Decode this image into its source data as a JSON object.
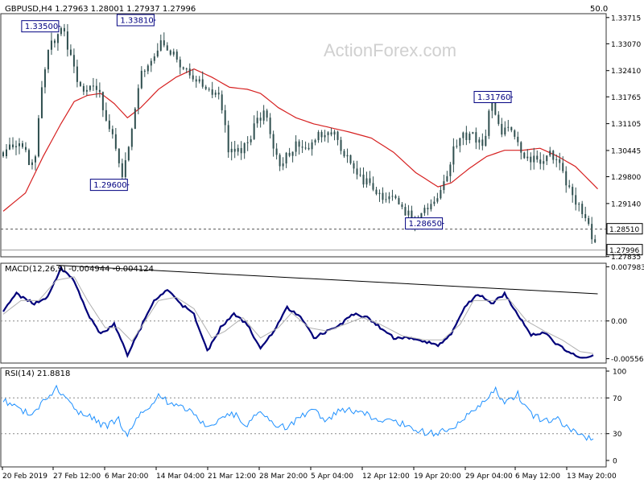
{
  "header": {
    "symbol_info": "GBPUSD,H4  1.27963 1.28001 1.27937 1.27996",
    "corner_value": "50.0",
    "watermark": "ActionForex.com"
  },
  "colors": {
    "candle": "#2f4f4f",
    "ma": "#d62020",
    "macd": "#00007a",
    "signal": "#b0b0b0",
    "rsi": "#1e90ff",
    "callout": "#000080",
    "grid": "#333333"
  },
  "chart_data": [
    {
      "type": "candlestick",
      "panel": "price",
      "title": "",
      "ylim": [
        1.2783,
        1.3381
      ],
      "y_ticks": [
        "1.33715",
        "1.33070",
        "1.32410",
        "1.31765",
        "1.31105",
        "1.30445",
        "1.29800",
        "1.29140",
        "1.28510",
        "1.27996",
        "1.27835"
      ],
      "x_ticks": [
        "20 Feb 2019",
        "27 Feb 12:00",
        "6 Mar 20:00",
        "14 Mar 04:00",
        "21 Mar 12:00",
        "28 Mar 20:00",
        "5 Apr 04:00",
        "12 Apr 12:00",
        "19 Apr 20:00",
        "29 Apr 04:00",
        "6 May 12:00",
        "13 May 20:00"
      ],
      "bars_shown": 185,
      "anchors": [
        [
          0,
          1.304
        ],
        [
          8,
          1.306
        ],
        [
          14,
          1.299
        ],
        [
          18,
          1.324
        ],
        [
          22,
          1.3305
        ],
        [
          27,
          1.335
        ],
        [
          30,
          1.328
        ],
        [
          35,
          1.32
        ],
        [
          42,
          1.3205
        ],
        [
          47,
          1.312
        ],
        [
          54,
          1.2975
        ],
        [
          57,
          1.306
        ],
        [
          62,
          1.3235
        ],
        [
          66,
          1.326
        ],
        [
          72,
          1.331
        ],
        [
          78,
          1.327
        ],
        [
          85,
          1.322
        ],
        [
          90,
          1.3215
        ],
        [
          98,
          1.318
        ],
        [
          102,
          1.3035
        ],
        [
          108,
          1.304
        ],
        [
          112,
          1.309
        ],
        [
          118,
          1.314
        ],
        [
          124,
          1.301
        ],
        [
          132,
          1.3065
        ],
        [
          138,
          1.306
        ],
        [
          142,
          1.309
        ],
        [
          150,
          1.3075
        ],
        [
          156,
          1.3015
        ],
        [
          160,
          1.299
        ],
        [
          164,
          1.296
        ],
        [
          170,
          1.2935
        ],
        [
          176,
          1.2925
        ],
        [
          182,
          1.2895
        ],
        [
          186,
          1.287
        ],
        [
          194,
          1.292
        ],
        [
          200,
          1.2975
        ],
        [
          204,
          1.3065
        ],
        [
          210,
          1.3085
        ],
        [
          216,
          1.305
        ],
        [
          220,
          1.317
        ],
        [
          224,
          1.308
        ],
        [
          228,
          1.3115
        ],
        [
          232,
          1.305
        ],
        [
          236,
          1.3035
        ],
        [
          242,
          1.3015
        ],
        [
          246,
          1.304
        ],
        [
          252,
          1.299
        ],
        [
          256,
          1.2935
        ],
        [
          262,
          1.288
        ],
        [
          266,
          1.283
        ],
        [
          268,
          1.28
        ]
      ],
      "moving_average_anchors": [
        [
          0,
          1.2895
        ],
        [
          10,
          1.294
        ],
        [
          18,
          1.303
        ],
        [
          26,
          1.311
        ],
        [
          32,
          1.3165
        ],
        [
          38,
          1.318
        ],
        [
          44,
          1.3185
        ],
        [
          50,
          1.316
        ],
        [
          56,
          1.3125
        ],
        [
          62,
          1.315
        ],
        [
          70,
          1.3195
        ],
        [
          78,
          1.3225
        ],
        [
          86,
          1.3245
        ],
        [
          94,
          1.3225
        ],
        [
          102,
          1.32
        ],
        [
          110,
          1.3195
        ],
        [
          116,
          1.3185
        ],
        [
          124,
          1.315
        ],
        [
          132,
          1.3125
        ],
        [
          140,
          1.311
        ],
        [
          148,
          1.31
        ],
        [
          156,
          1.309
        ],
        [
          166,
          1.3075
        ],
        [
          176,
          1.304
        ],
        [
          186,
          1.299
        ],
        [
          196,
          1.2955
        ],
        [
          202,
          1.2965
        ],
        [
          210,
          1.3
        ],
        [
          218,
          1.303
        ],
        [
          226,
          1.3045
        ],
        [
          234,
          1.3045
        ],
        [
          242,
          1.305
        ],
        [
          250,
          1.303
        ],
        [
          258,
          1.3005
        ],
        [
          268,
          1.295
        ]
      ],
      "callouts": [
        {
          "label": "1.33500",
          "i": 25,
          "price": 1.335,
          "pos": "left"
        },
        {
          "label": "1.33810",
          "i": 68,
          "price": 1.3381,
          "pos": "left"
        },
        {
          "label": "1.29600",
          "i": 56,
          "price": 1.296,
          "pos": "left"
        },
        {
          "label": "1.31760",
          "i": 229,
          "price": 1.3176,
          "pos": "left"
        },
        {
          "label": "1.28650",
          "i": 198,
          "price": 1.2865,
          "pos": "left"
        }
      ],
      "reference_lines": [
        {
          "price": 1.2851,
          "label": "1.28510",
          "style": "dashed"
        },
        {
          "price": 1.27996,
          "label": "1.27996",
          "style": "solid"
        }
      ]
    },
    {
      "type": "line",
      "panel": "macd",
      "title": "MACD(12,26,9) -0.004944 -0.004124",
      "ylim": [
        -0.0062,
        0.0085
      ],
      "y_ticks": [
        {
          "label": "0.007983",
          "value": 0.007983
        },
        {
          "label": "0.00",
          "value": 0.0
        },
        {
          "label": "-0.00556",
          "value": -0.00556
        }
      ],
      "series": [
        {
          "values": [
            [
              0,
              0.0015
            ],
            [
              6,
              0.004
            ],
            [
              14,
              0.0025
            ],
            [
              20,
              0.0035
            ],
            [
              26,
              0.0078
            ],
            [
              32,
              0.006
            ],
            [
              38,
              0.001
            ],
            [
              44,
              -0.002
            ],
            [
              50,
              -0.0005
            ],
            [
              56,
              -0.005
            ],
            [
              62,
              -0.001
            ],
            [
              68,
              0.003
            ],
            [
              74,
              0.0045
            ],
            [
              80,
              0.0025
            ],
            [
              86,
              0.001
            ],
            [
              92,
              -0.0045
            ],
            [
              98,
              -0.001
            ],
            [
              104,
              0.001
            ],
            [
              110,
              -0.0005
            ],
            [
              116,
              -0.004
            ],
            [
              122,
              -0.0015
            ],
            [
              128,
              0.002
            ],
            [
              134,
              0.0005
            ],
            [
              140,
              -0.0025
            ],
            [
              146,
              -0.0015
            ],
            [
              152,
              -0.0005
            ],
            [
              158,
              0.001
            ],
            [
              164,
              0.0005
            ],
            [
              170,
              -0.001
            ],
            [
              176,
              -0.0025
            ],
            [
              182,
              -0.0025
            ],
            [
              190,
              -0.003
            ],
            [
              196,
              -0.0035
            ],
            [
              202,
              -0.002
            ],
            [
              208,
              0.002
            ],
            [
              214,
              0.004
            ],
            [
              220,
              0.0025
            ],
            [
              226,
              0.004
            ],
            [
              232,
              0.001
            ],
            [
              238,
              -0.002
            ],
            [
              244,
              -0.0018
            ],
            [
              250,
              -0.0035
            ],
            [
              256,
              -0.0048
            ],
            [
              262,
              -0.0055
            ],
            [
              266,
              -0.0052
            ]
          ]
        },
        {
          "values": [
            [
              0,
              0.001
            ],
            [
              8,
              0.003
            ],
            [
              16,
              0.003
            ],
            [
              24,
              0.006
            ],
            [
              32,
              0.0065
            ],
            [
              38,
              0.003
            ],
            [
              46,
              -0.001
            ],
            [
              52,
              -0.001
            ],
            [
              58,
              -0.003
            ],
            [
              64,
              0.0
            ],
            [
              70,
              0.003
            ],
            [
              78,
              0.0035
            ],
            [
              86,
              0.0018
            ],
            [
              94,
              -0.0025
            ],
            [
              100,
              -0.0015
            ],
            [
              108,
              0.0005
            ],
            [
              116,
              -0.0025
            ],
            [
              124,
              -0.001
            ],
            [
              130,
              0.0012
            ],
            [
              138,
              -0.001
            ],
            [
              146,
              -0.0015
            ],
            [
              154,
              -0.0005
            ],
            [
              162,
              0.0005
            ],
            [
              170,
              -0.0005
            ],
            [
              180,
              -0.0022
            ],
            [
              190,
              -0.0028
            ],
            [
              198,
              -0.0028
            ],
            [
              206,
              -0.0005
            ],
            [
              212,
              0.003
            ],
            [
              220,
              0.003
            ],
            [
              228,
              0.0032
            ],
            [
              236,
              0.0
            ],
            [
              244,
              -0.0015
            ],
            [
              252,
              -0.0028
            ],
            [
              260,
              -0.0045
            ],
            [
              266,
              -0.0048
            ]
          ]
        }
      ],
      "trendline": [
        [
          24,
          0.0082
        ],
        [
          268,
          0.004
        ]
      ]
    },
    {
      "type": "line",
      "panel": "rsi",
      "title": "RSI(14) 21.8818",
      "ylim": [
        0,
        100
      ],
      "y_ticks": [
        "100",
        "70",
        "30",
        "0"
      ],
      "levels": [
        70,
        30
      ],
      "series": [
        {
          "values": [
            [
              0,
              68
            ],
            [
              6,
              60
            ],
            [
              12,
              52
            ],
            [
              18,
              65
            ],
            [
              24,
              80
            ],
            [
              28,
              70
            ],
            [
              34,
              55
            ],
            [
              40,
              48
            ],
            [
              46,
              38
            ],
            [
              52,
              45
            ],
            [
              56,
              28
            ],
            [
              60,
              50
            ],
            [
              66,
              62
            ],
            [
              70,
              74
            ],
            [
              74,
              65
            ],
            [
              80,
              60
            ],
            [
              86,
              54
            ],
            [
              92,
              35
            ],
            [
              98,
              48
            ],
            [
              104,
              52
            ],
            [
              110,
              40
            ],
            [
              116,
              55
            ],
            [
              122,
              42
            ],
            [
              128,
              36
            ],
            [
              134,
              48
            ],
            [
              140,
              55
            ],
            [
              146,
              44
            ],
            [
              152,
              58
            ],
            [
              158,
              54
            ],
            [
              164,
              52
            ],
            [
              170,
              42
            ],
            [
              176,
              46
            ],
            [
              182,
              38
            ],
            [
              188,
              33
            ],
            [
              194,
              30
            ],
            [
              200,
              36
            ],
            [
              206,
              42
            ],
            [
              212,
              58
            ],
            [
              218,
              68
            ],
            [
              222,
              80
            ],
            [
              226,
              62
            ],
            [
              232,
              74
            ],
            [
              238,
              52
            ],
            [
              244,
              45
            ],
            [
              250,
              47
            ],
            [
              254,
              38
            ],
            [
              258,
              34
            ],
            [
              262,
              28
            ],
            [
              266,
              21.88
            ]
          ]
        }
      ]
    }
  ]
}
